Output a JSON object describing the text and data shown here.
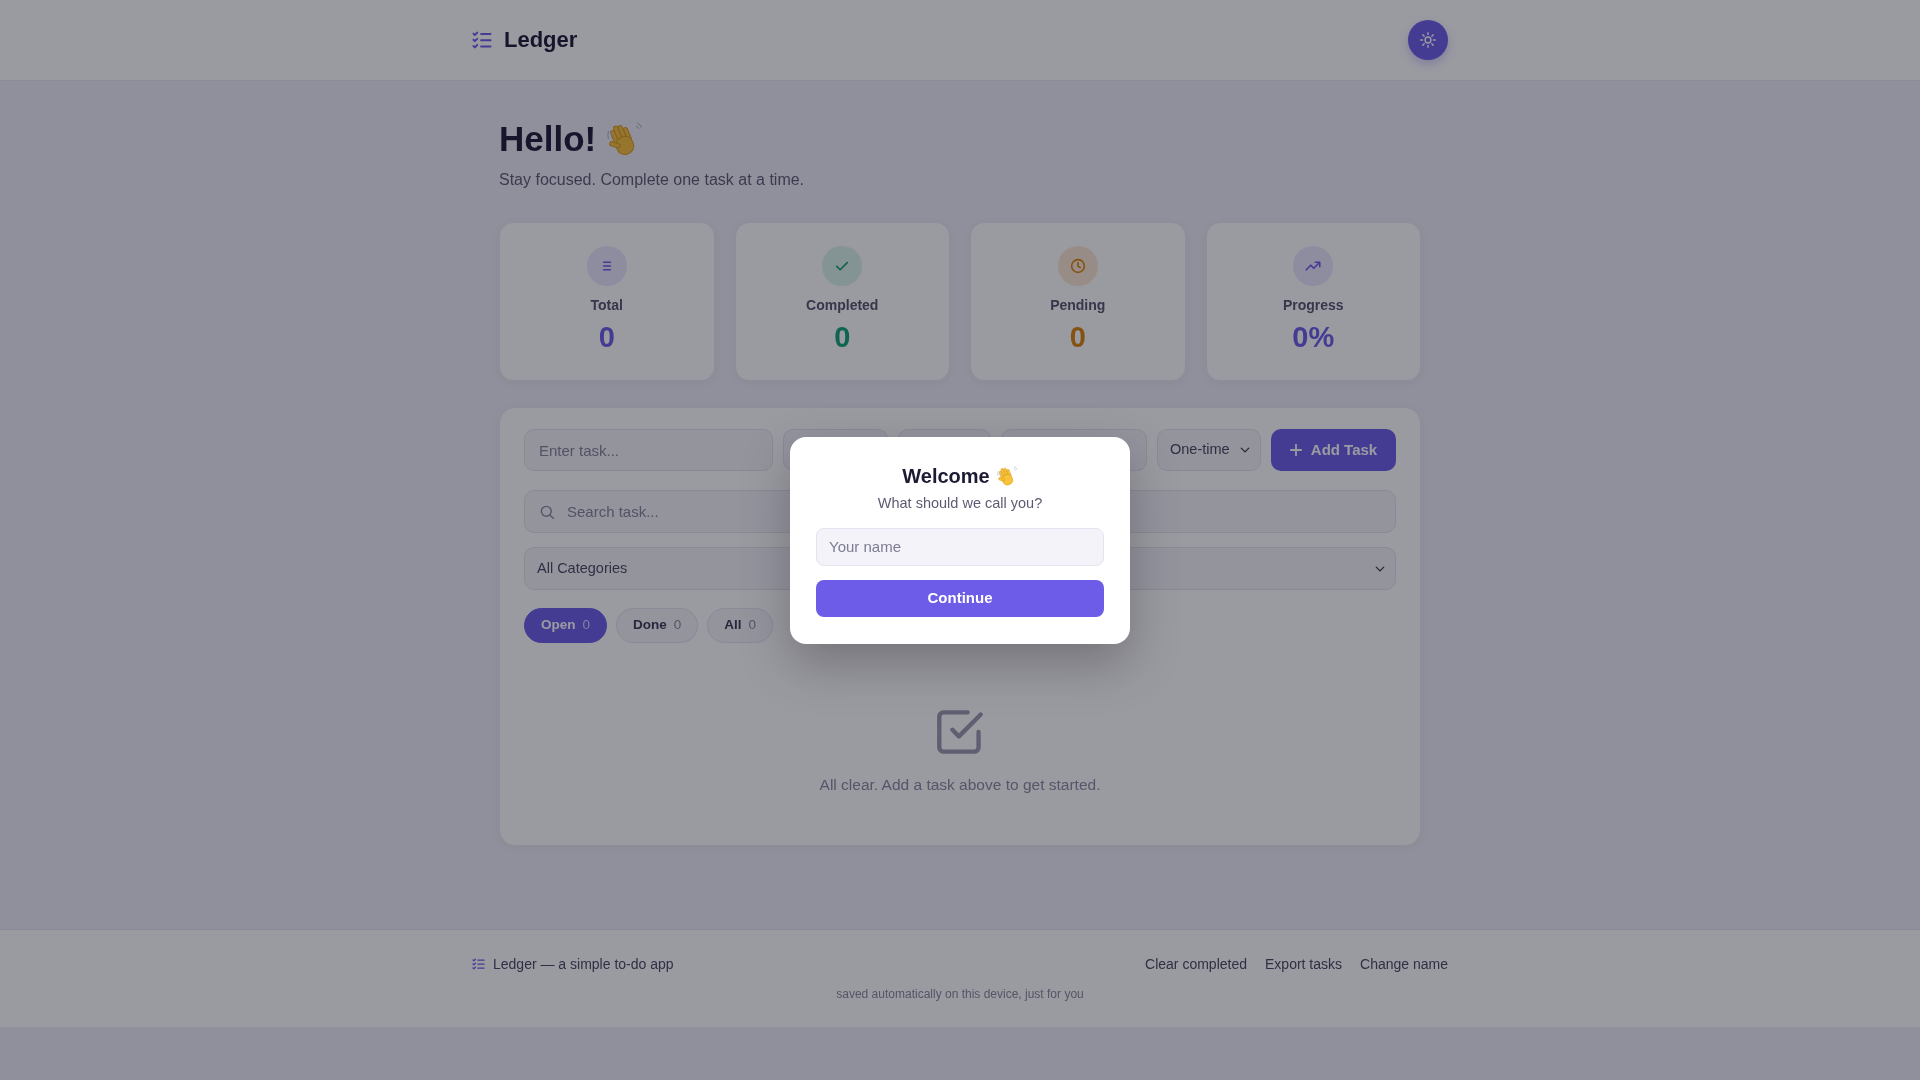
{
  "header": {
    "brand": "Ledger"
  },
  "greeting": {
    "title": "Hello!",
    "subtitle": "Stay focused. Complete one task at a time."
  },
  "stats": [
    {
      "kind": "total",
      "label": "Total",
      "value": "0"
    },
    {
      "kind": "completed",
      "label": "Completed",
      "value": "0"
    },
    {
      "kind": "pending",
      "label": "Pending",
      "value": "0"
    },
    {
      "kind": "progress",
      "label": "Progress",
      "value": "0%"
    }
  ],
  "task_form": {
    "fields": [
      {
        "kind": "text",
        "placeholder": "Enter task..."
      },
      {
        "kind": "blank"
      },
      {
        "kind": "blank"
      },
      {
        "kind": "blank"
      },
      {
        "kind": "select",
        "value": "One-time"
      }
    ],
    "add_button": "Add Task"
  },
  "search": {
    "placeholder": "Search task..."
  },
  "category_filter": {
    "value": "All Categories"
  },
  "filter_tabs": [
    {
      "label": "Open",
      "count": "0",
      "selected": true
    },
    {
      "label": "Done",
      "count": "0",
      "selected": false
    },
    {
      "label": "All",
      "count": "0",
      "selected": false
    }
  ],
  "empty_state": {
    "message": "All clear. Add a task above to get started."
  },
  "footer": {
    "brand": "Ledger — a simple to-do app",
    "links": [
      "Clear completed",
      "Export tasks",
      "Change name"
    ],
    "note": "saved automatically on this device, just for you"
  },
  "welcome_dialog": {
    "title": "Welcome",
    "subtitle": "What should we call you?",
    "name_field": {
      "placeholder": "Your name"
    },
    "button": "Continue"
  }
}
